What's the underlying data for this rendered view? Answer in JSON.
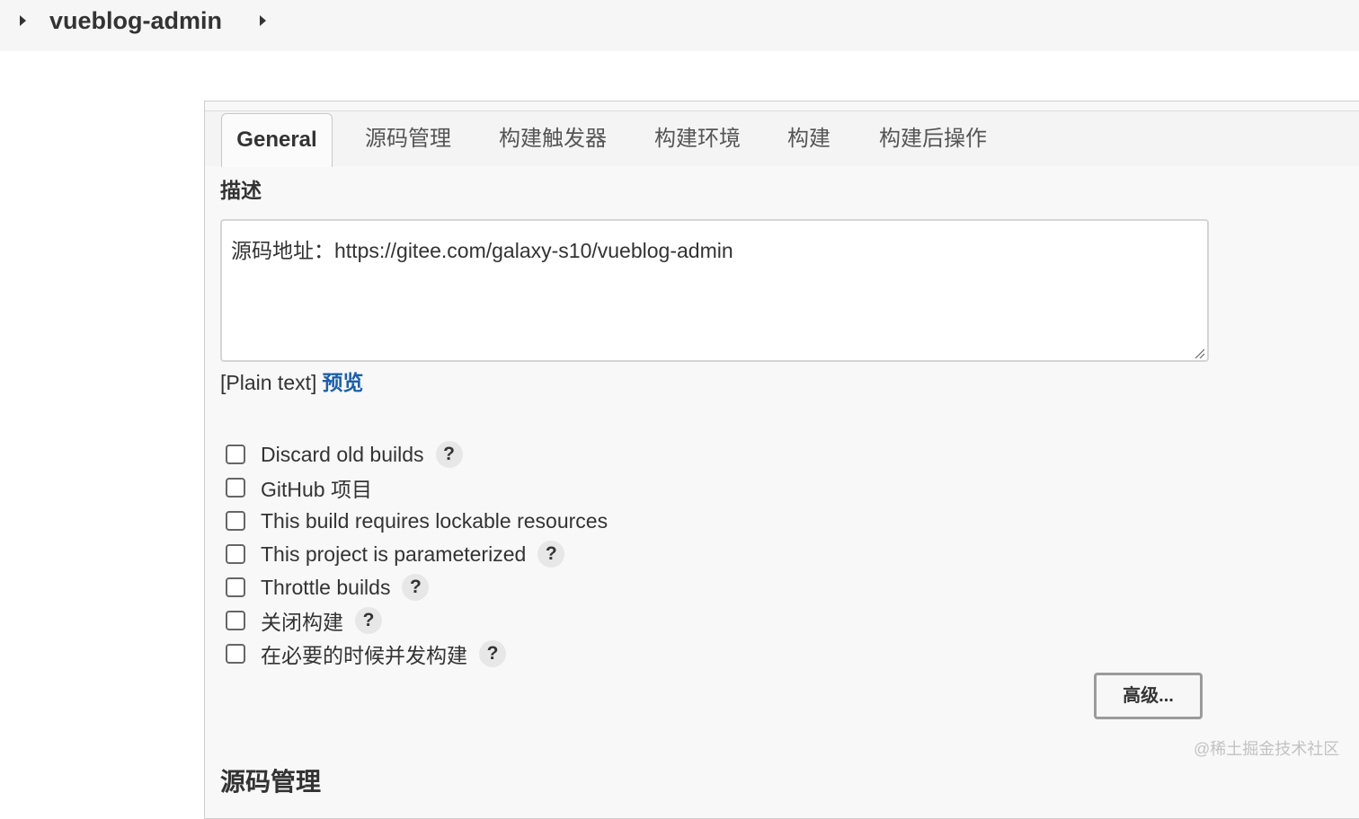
{
  "breadcrumb": {
    "project": "vueblog-admin"
  },
  "tabs": [
    "General",
    "源码管理",
    "构建触发器",
    "构建环境",
    "构建",
    "构建后操作"
  ],
  "general": {
    "description_label": "描述",
    "description_value": "源码地址：https://gitee.com/galaxy-s10/vueblog-admin",
    "format_text": "[Plain text]",
    "preview_link": "预览",
    "options": [
      {
        "label": "Discard old builds",
        "checked": false,
        "help": true
      },
      {
        "label": "GitHub 项目",
        "checked": false,
        "help": false
      },
      {
        "label": "This build requires lockable resources",
        "checked": false,
        "help": false
      },
      {
        "label": "This project is parameterized",
        "checked": false,
        "help": true
      },
      {
        "label": "Throttle builds",
        "checked": false,
        "help": true
      },
      {
        "label": "关闭构建",
        "checked": false,
        "help": true
      },
      {
        "label": "在必要的时候并发构建",
        "checked": false,
        "help": true
      }
    ],
    "help_glyph": "?",
    "advanced_button": "高级..."
  },
  "next_section_heading": "源码管理",
  "watermark": "@稀土掘金技术社区"
}
